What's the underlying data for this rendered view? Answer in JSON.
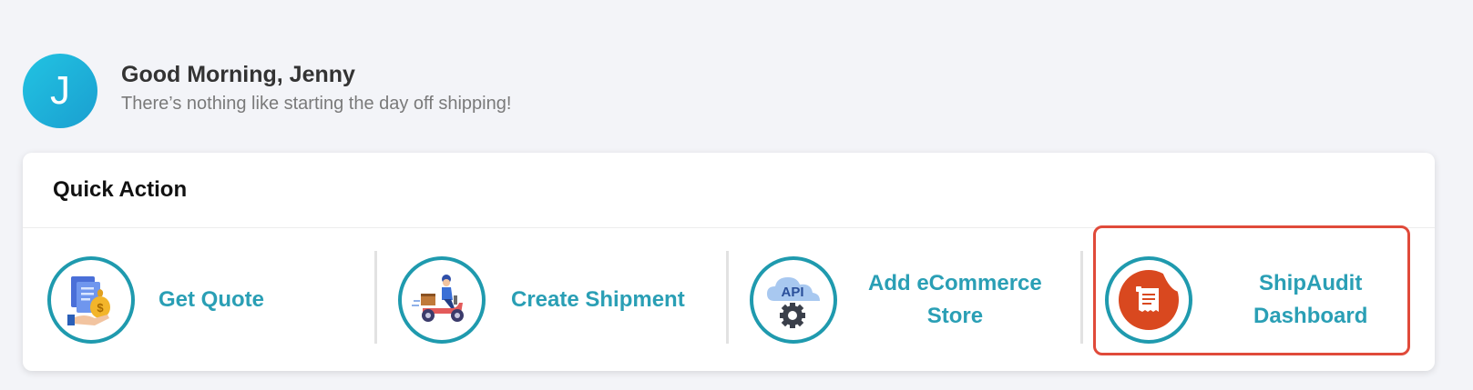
{
  "greeting": {
    "avatar_initial": "J",
    "title": "Good Morning, Jenny",
    "subtitle": "There’s nothing like starting the day off shipping!"
  },
  "quick_action": {
    "title": "Quick Action",
    "items": [
      {
        "label": "Get Quote",
        "icon": "quote-money-icon"
      },
      {
        "label": "Create Shipment",
        "icon": "delivery-scooter-icon"
      },
      {
        "label_line1": "Add eCommerce",
        "label_line2": "Store",
        "icon": "api-cloud-gear-icon"
      },
      {
        "label_line1": "ShipAudit",
        "label_line2": "Dashboard",
        "icon": "receipt-icon",
        "highlighted": true
      }
    ]
  },
  "colors": {
    "accent": "#2a9fb5",
    "ring": "#1f9aae",
    "highlight": "#e04a3a",
    "background": "#f3f4f8"
  }
}
